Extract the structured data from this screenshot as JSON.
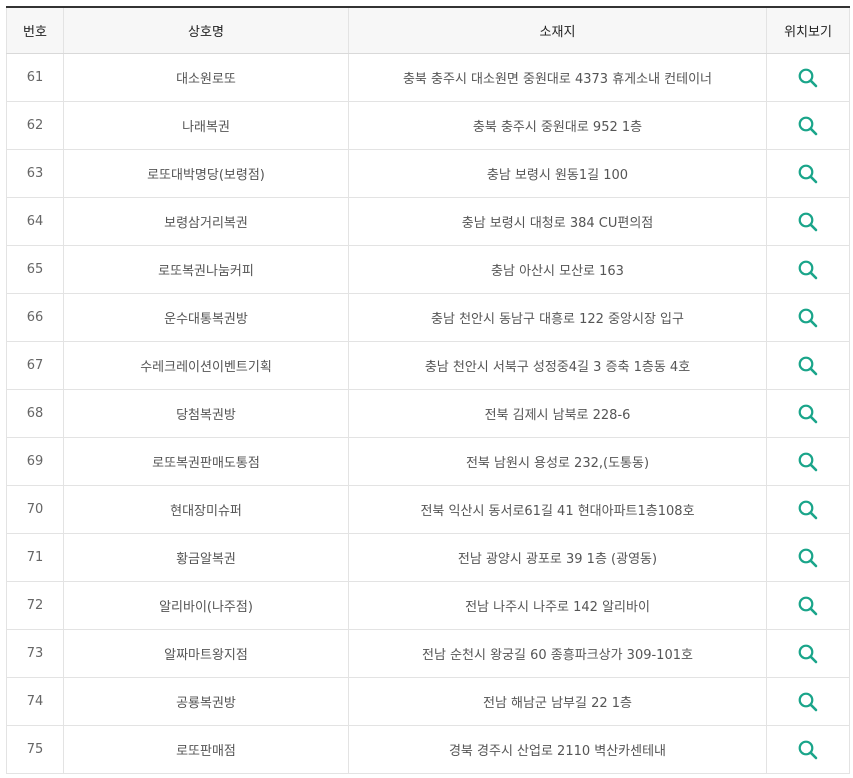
{
  "table": {
    "headers": {
      "num": "번호",
      "name": "상호명",
      "address": "소재지",
      "map": "위치보기"
    },
    "rows": [
      {
        "num": "61",
        "name": "대소원로또",
        "address": "충북 충주시 대소원면 중원대로 4373 휴게소내 컨테이너"
      },
      {
        "num": "62",
        "name": "나래복권",
        "address": "충북 충주시 중원대로 952 1층"
      },
      {
        "num": "63",
        "name": "로또대박명당(보령점)",
        "address": "충남 보령시 원동1길 100"
      },
      {
        "num": "64",
        "name": "보령삼거리복권",
        "address": "충남 보령시 대청로 384 CU편의점"
      },
      {
        "num": "65",
        "name": "로또복권나눔커피",
        "address": "충남 아산시 모산로 163"
      },
      {
        "num": "66",
        "name": "운수대통복권방",
        "address": "충남 천안시 동남구 대흥로 122 중앙시장 입구"
      },
      {
        "num": "67",
        "name": "수레크레이션이벤트기획",
        "address": "충남 천안시 서북구 성정중4길 3 증축 1층동 4호"
      },
      {
        "num": "68",
        "name": "당첨복권방",
        "address": "전북 김제시 남북로 228-6"
      },
      {
        "num": "69",
        "name": "로또복권판매도통점",
        "address": "전북 남원시 용성로 232,(도통동)"
      },
      {
        "num": "70",
        "name": "현대장미슈퍼",
        "address": "전북 익산시 동서로61길 41 현대아파트1층108호"
      },
      {
        "num": "71",
        "name": "황금알복권",
        "address": "전남 광양시 광포로 39 1층 (광영동)"
      },
      {
        "num": "72",
        "name": "알리바이(나주점)",
        "address": "전남 나주시 나주로 142 알리바이"
      },
      {
        "num": "73",
        "name": "알짜마트왕지점",
        "address": "전남 순천시 왕궁길 60 종흥파크상가 309-101호"
      },
      {
        "num": "74",
        "name": "공룡복권방",
        "address": "전남 해남군 남부길 22 1층"
      },
      {
        "num": "75",
        "name": "로또판매점",
        "address": "경북 경주시 산업로 2110 벽산카센테내"
      }
    ]
  },
  "colors": {
    "accent": "#1aa58a",
    "header_bg": "#f7f7f7",
    "border": "#e3e3e3",
    "top_border": "#333333"
  },
  "icons": {
    "map": "search-icon"
  }
}
